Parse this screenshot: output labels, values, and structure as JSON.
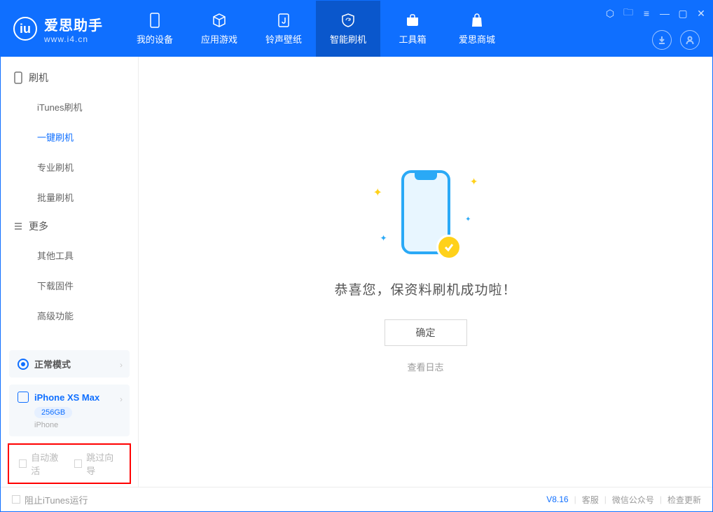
{
  "app": {
    "name_cn": "爱思助手",
    "url": "www.i4.cn"
  },
  "nav": {
    "items": [
      {
        "label": "我的设备"
      },
      {
        "label": "应用游戏"
      },
      {
        "label": "铃声壁纸"
      },
      {
        "label": "智能刷机"
      },
      {
        "label": "工具箱"
      },
      {
        "label": "爱思商城"
      }
    ]
  },
  "sidebar": {
    "group1_title": "刷机",
    "group1_items": [
      {
        "label": "iTunes刷机"
      },
      {
        "label": "一键刷机"
      },
      {
        "label": "专业刷机"
      },
      {
        "label": "批量刷机"
      }
    ],
    "group2_title": "更多",
    "group2_items": [
      {
        "label": "其他工具"
      },
      {
        "label": "下载固件"
      },
      {
        "label": "高级功能"
      }
    ]
  },
  "mode_card": {
    "label": "正常模式"
  },
  "device_card": {
    "name": "iPhone XS Max",
    "storage": "256GB",
    "type": "iPhone"
  },
  "red_options": {
    "opt1": "自动激活",
    "opt2": "跳过向导"
  },
  "main": {
    "success_text": "恭喜您，保资料刷机成功啦！",
    "ok_button": "确定",
    "log_link": "查看日志"
  },
  "footer": {
    "block_itunes": "阻止iTunes运行",
    "version": "V8.16",
    "link1": "客服",
    "link2": "微信公众号",
    "link3": "检查更新"
  }
}
